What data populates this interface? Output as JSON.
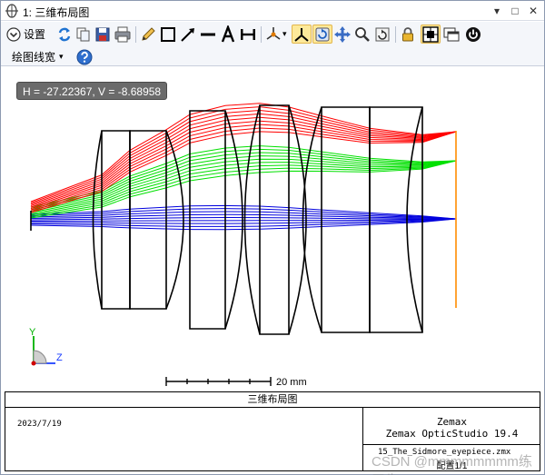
{
  "window": {
    "title": "1: 三维布局图",
    "controls": [
      "▾",
      "□",
      "✕"
    ]
  },
  "toolbar": {
    "settings_label": "设置",
    "line_width_label": "绘图线宽",
    "dropdown_caret": "▾",
    "help_icon": "help-icon"
  },
  "readout": {
    "text": "H = -27.22367, V = -8.68958"
  },
  "layout": {
    "scale_label": "20 mm",
    "axis_y": "Y",
    "axis_z": "Z"
  },
  "title_block": {
    "caption": "三维布局图",
    "date": "2023/7/19",
    "brand": "Zemax",
    "product": "Zemax OpticStudio 19.4",
    "file": "15_The_Sidmore_eyepiece.zmx",
    "config": "配置1/1"
  },
  "watermark": "CSDN @mmmmmmmm练习生",
  "colors": {
    "red_rays": "#ff0000",
    "green_rays": "#00e000",
    "blue_rays": "#0000dd",
    "image_plane": "#ff8c00",
    "toolbar_active": "#fde99a"
  }
}
